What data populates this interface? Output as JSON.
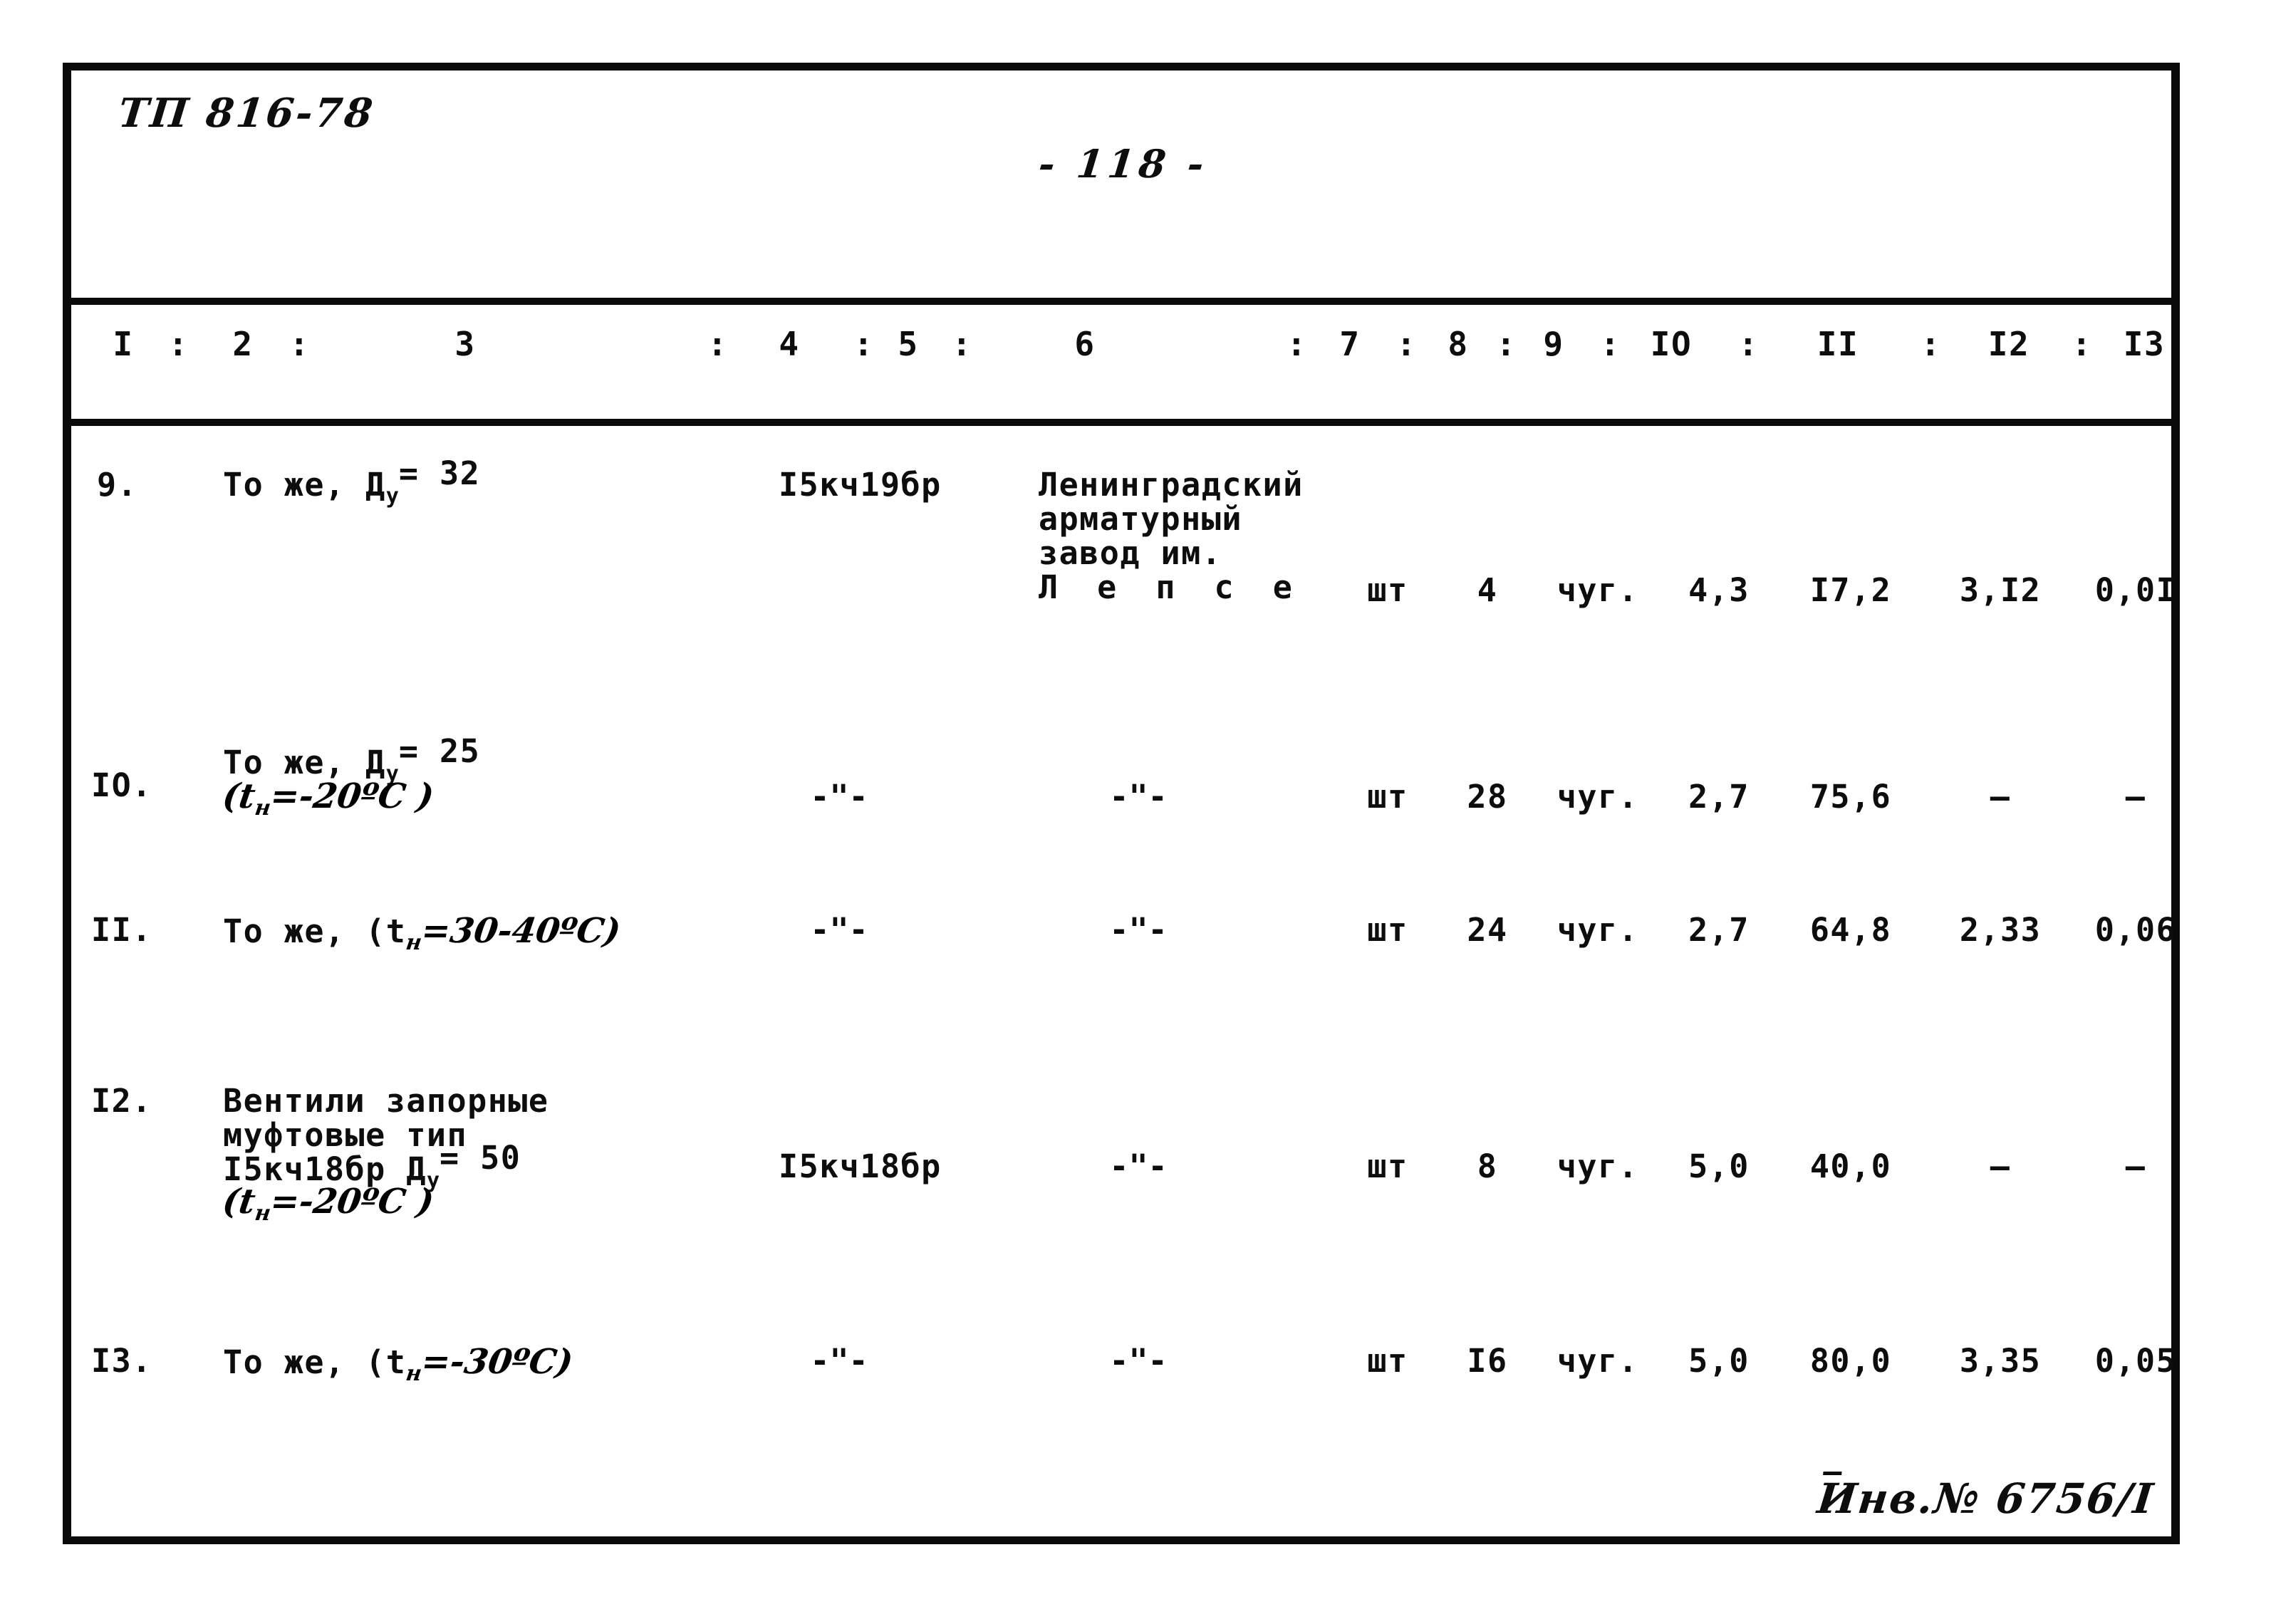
{
  "document": {
    "code": "ТП 816-78",
    "page_label": "- 118 -",
    "page_number": "118",
    "inventory_stamp": "Инв.№ 6756/I"
  },
  "table": {
    "column_numbers": [
      "I",
      "2",
      "3",
      "4",
      "5",
      "6",
      "7",
      "8",
      "9",
      "IO",
      "II",
      "I2",
      "I3"
    ],
    "separator": ":",
    "rows": [
      {
        "index": "9.",
        "name_line1": "То же, Д",
        "name_sub1": "у",
        "name_eq1": "= 32",
        "name_line2": "",
        "name_line3": "",
        "name_line4": "",
        "mark": "I5кч19бр",
        "maker_line1": "Ленинградский",
        "maker_line2": "арматурный",
        "maker_line3": "завод им.",
        "maker_line4": "Л е п с е",
        "unit": "шт",
        "qty": "4",
        "material": "чуг.",
        "mass_unit": "4,3",
        "mass_total": "I7,2",
        "col12": "3,I2",
        "col13": "0,0I"
      },
      {
        "index": "IO.",
        "name_line1": "То же, Д",
        "name_sub1": "у",
        "name_eq1": "= 25",
        "name_line2": "(t",
        "name_sub2": "н",
        "name_eq2": "=-20ºС )",
        "name_line3": "",
        "name_line4": "",
        "mark": "-\"-",
        "maker_line1": "-\"-",
        "maker_line2": "",
        "maker_line3": "",
        "maker_line4": "",
        "unit": "шт",
        "qty": "28",
        "material": "чуг.",
        "mass_unit": "2,7",
        "mass_total": "75,6",
        "col12": "—",
        "col13": "—"
      },
      {
        "index": "II.",
        "name_line1": "То же, (t",
        "name_sub1": "н",
        "name_eq1": "=30-40ºС)",
        "name_line2": "",
        "name_line3": "",
        "name_line4": "",
        "mark": "-\"-",
        "maker_line1": "-\"-",
        "maker_line2": "",
        "maker_line3": "",
        "maker_line4": "",
        "unit": "шт",
        "qty": "24",
        "material": "чуг.",
        "mass_unit": "2,7",
        "mass_total": "64,8",
        "col12": "2,33",
        "col13": "0,06"
      },
      {
        "index": "I2.",
        "name_line1": "Вентили запорные",
        "name_line2": "муфтовые тип",
        "name_line3": "I5кч18бр Д",
        "name_sub3": "у",
        "name_eq3": "= 50",
        "name_line4": "(t",
        "name_sub4": "н",
        "name_eq4": "=-20ºС )",
        "mark": "I5кч18бр",
        "maker_line1": "-\"-",
        "maker_line2": "",
        "maker_line3": "",
        "maker_line4": "",
        "unit": "шт",
        "qty": "8",
        "material": "чуг.",
        "mass_unit": "5,0",
        "mass_total": "40,0",
        "col12": "—",
        "col13": "—"
      },
      {
        "index": "I3.",
        "name_line1": "То же, (t",
        "name_sub1": "н",
        "name_eq1": "=-30ºС)",
        "name_line2": "",
        "name_line3": "",
        "name_line4": "",
        "mark": "-\"-",
        "maker_line1": "-\"-",
        "maker_line2": "",
        "maker_line3": "",
        "maker_line4": "",
        "unit": "шт",
        "qty": "I6",
        "material": "чуг.",
        "mass_unit": "5,0",
        "mass_total": "80,0",
        "col12": "3,35",
        "col13": "0,05"
      }
    ]
  },
  "colors": {
    "ink": "#0d0d0d",
    "paper": "#ffffff"
  }
}
